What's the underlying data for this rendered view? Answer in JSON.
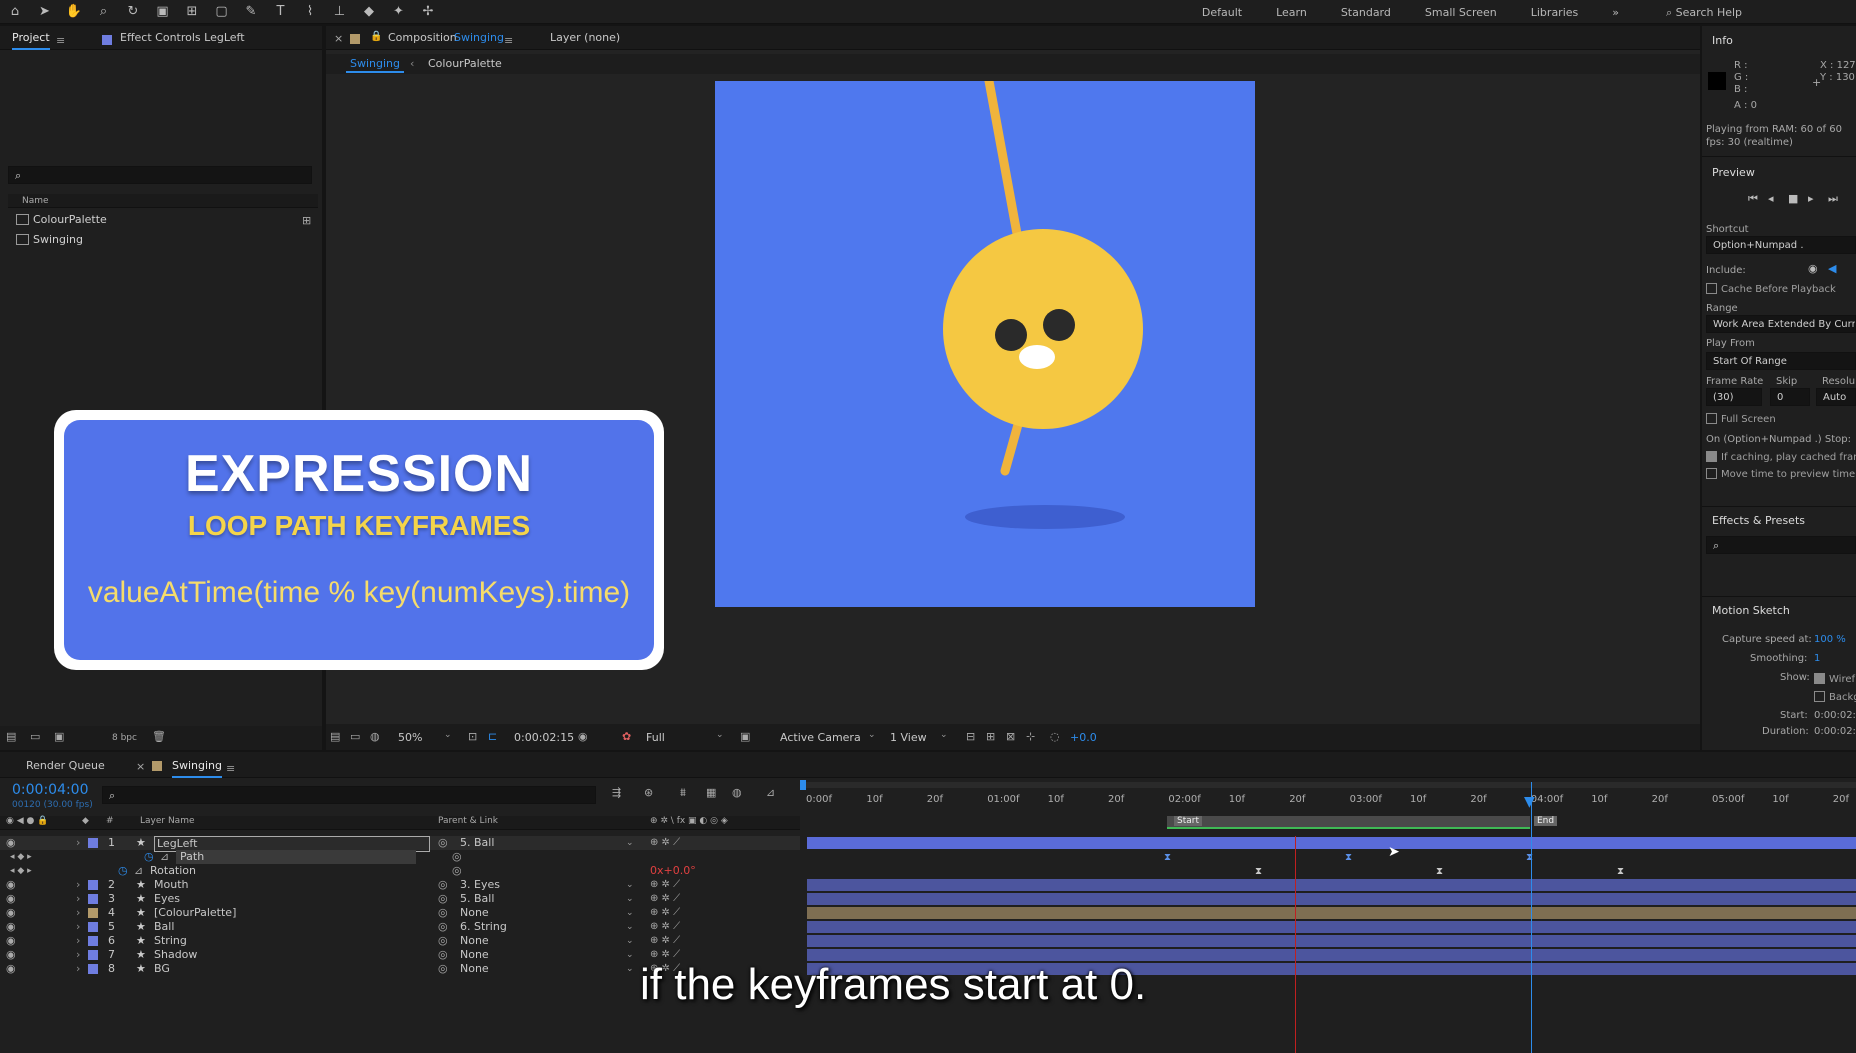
{
  "workspaces": [
    "Default",
    "Learn",
    "Standard",
    "Small Screen",
    "Libraries"
  ],
  "search_help": "Search Help",
  "project_panel": {
    "tab_project": "Project",
    "tab_effect_controls": "Effect Controls LegLeft",
    "column_name": "Name",
    "items": [
      "ColourPalette",
      "Swinging"
    ],
    "bpc": "8 bpc"
  },
  "comp_panel": {
    "tab_label": "Composition",
    "tab_comp_name": "Swinging",
    "layer_tab": "Layer (none)",
    "breadcrumb": [
      "Swinging",
      "ColourPalette"
    ],
    "zoom": "50%",
    "timecode": "0:00:02:15",
    "resolution": "Full",
    "camera": "Active Camera",
    "views": "1 View",
    "exposure": "+0.0"
  },
  "info_panel": {
    "title": "Info",
    "r": "R :",
    "g": "G :",
    "b": "B :",
    "a": "A : 0",
    "x": "X : 127",
    "y": "Y : 130",
    "playing": "Playing from RAM: 60 of 60",
    "fps": "fps: 30 (realtime)"
  },
  "preview_panel": {
    "title": "Preview",
    "shortcut_label": "Shortcut",
    "shortcut_value": "Option+Numpad .",
    "include_label": "Include:",
    "cache_before": "Cache Before Playback",
    "range_label": "Range",
    "range_value": "Work Area Extended By Curre",
    "play_from_label": "Play From",
    "play_from_value": "Start Of Range",
    "frame_rate_label": "Frame Rate",
    "skip_label": "Skip",
    "resolution_label": "Resolu",
    "frame_rate_value": "(30)",
    "skip_value": "0",
    "resolution_value": "Auto",
    "full_screen": "Full Screen",
    "on_stop": "On (Option+Numpad .) Stop:",
    "if_caching": "If caching, play cached fram",
    "move_time": "Move time to preview time"
  },
  "effects_presets": {
    "title": "Effects & Presets"
  },
  "motion_sketch": {
    "title": "Motion Sketch",
    "capture_label": "Capture speed at:",
    "capture_value": "100 %",
    "smoothing_label": "Smoothing:",
    "smoothing_value": "1",
    "show_label": "Show:",
    "wireframe": "Wiref",
    "background": "Backg",
    "start_label": "Start:",
    "start_value": "0:00:02:",
    "duration_label": "Duration:",
    "duration_value": "0:00:02:"
  },
  "timeline": {
    "tab_render_queue": "Render Queue",
    "tab_comp": "Swinging",
    "current_time": "0:00:04:00",
    "frames_fps": "00120 (30.00 fps)",
    "col_layer_name": "Layer Name",
    "col_parent": "Parent & Link",
    "ruler": [
      "0:00f",
      "10f",
      "20f",
      "01:00f",
      "10f",
      "20f",
      "02:00f",
      "10f",
      "20f",
      "03:00f",
      "10f",
      "20f",
      "04:00f",
      "10f",
      "20f",
      "05:00f",
      "10f",
      "20f"
    ],
    "work_start": "Start",
    "work_end": "End",
    "rotation_value": "0x+0.0°",
    "layers": [
      {
        "num": "1",
        "name": "LegLeft",
        "parent": "5. Ball",
        "color": "#6f7de0"
      },
      {
        "num": "",
        "name": "Path",
        "parent": "",
        "color": ""
      },
      {
        "num": "",
        "name": "Rotation",
        "parent": "",
        "color": ""
      },
      {
        "num": "2",
        "name": "Mouth",
        "parent": "3. Eyes",
        "color": "#6f7de0"
      },
      {
        "num": "3",
        "name": "Eyes",
        "parent": "5. Ball",
        "color": "#6f7de0"
      },
      {
        "num": "4",
        "name": "[ColourPalette]",
        "parent": "None",
        "color": "#b39a6a"
      },
      {
        "num": "5",
        "name": "Ball",
        "parent": "6. String",
        "color": "#6f7de0"
      },
      {
        "num": "6",
        "name": "String",
        "parent": "None",
        "color": "#6f7de0"
      },
      {
        "num": "7",
        "name": "Shadow",
        "parent": "None",
        "color": "#6f7de0"
      },
      {
        "num": "8",
        "name": "BG",
        "parent": "None",
        "color": "#6f7de0"
      }
    ]
  },
  "overlay": {
    "title": "EXPRESSION",
    "subtitle": "LOOP PATH KEYFRAMES",
    "code": "valueAtTime(time % key(numKeys).time)"
  },
  "caption": "if the keyframes start at 0.",
  "colors": {
    "accent": "#2d8ceb",
    "comp_bg": "#4f78ee",
    "ball": "#f5c842",
    "leg": "#f0b43c",
    "card_bg": "#5273ea",
    "playhead": "#c02020"
  }
}
